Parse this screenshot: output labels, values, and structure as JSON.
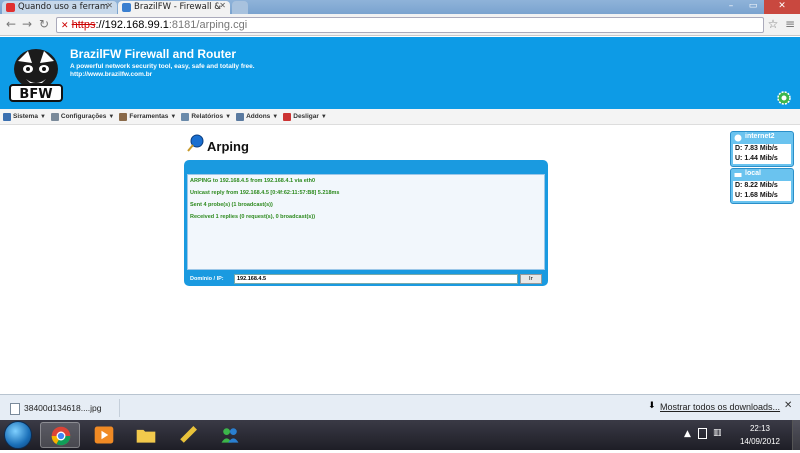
{
  "browser": {
    "tabs": [
      {
        "label": "Quando uso a ferram",
        "active": false
      },
      {
        "label": "BrazilFW - Firewall &",
        "active": true
      }
    ],
    "url": {
      "scheme": "https",
      "host": "://192.168.99.1",
      "rest": ":8181/arping.cgi"
    }
  },
  "header": {
    "logo_text": "BFW",
    "title": "BrazilFW Firewall and Router",
    "tagline": "A powerful network security tool, easy, safe and totally free.",
    "site": "http://www.brazilfw.com.br"
  },
  "menu": [
    {
      "label": "Sistema",
      "icon": "monitor-icon",
      "color": "#3a6fb0"
    },
    {
      "label": "Configurações",
      "icon": "wrench-icon",
      "color": "#7a8a9a"
    },
    {
      "label": "Ferramentas",
      "icon": "tools-icon",
      "color": "#8a6a4a"
    },
    {
      "label": "Relatórios",
      "icon": "report-icon",
      "color": "#6a8aaa"
    },
    {
      "label": "Addons",
      "icon": "addons-icon",
      "color": "#5a7aa0"
    },
    {
      "label": "Desligar",
      "icon": "power-icon",
      "color": "#cc3333"
    }
  ],
  "arping": {
    "title": "Arping",
    "output": [
      "ARPING to 192.168.4.5 from 192.168.4.1 via eth0",
      "Unicast reply from 192.168.4.5 [0:4f:62:11:57:B8] 5.218ms",
      "Sent 4 probe(s) (1 broadcast(s))",
      "Received 1 replies (0 request(s), 0 broadcast(s))"
    ],
    "domain_label": "Domínio / IP:",
    "domain_value": "192.168.4.5",
    "ok_label": "Ir"
  },
  "interfaces": [
    {
      "name": "internet2",
      "down": "D: 7.83 Mib/s",
      "up": "U: 1.44 Mib/s"
    },
    {
      "name": "local",
      "down": "D: 8.22 Mib/s",
      "up": "U: 1.68 Mib/s"
    }
  ],
  "downloads": {
    "file": "38400d134618....jpg",
    "show_all": "Mostrar todos os downloads..."
  },
  "taskbar": {
    "time": "22:13",
    "date": "14/09/2012"
  },
  "colors": {
    "header_blue": "#0d9be6",
    "panel_blue": "#1a9ae0",
    "output_green": "#2d8a1e"
  }
}
